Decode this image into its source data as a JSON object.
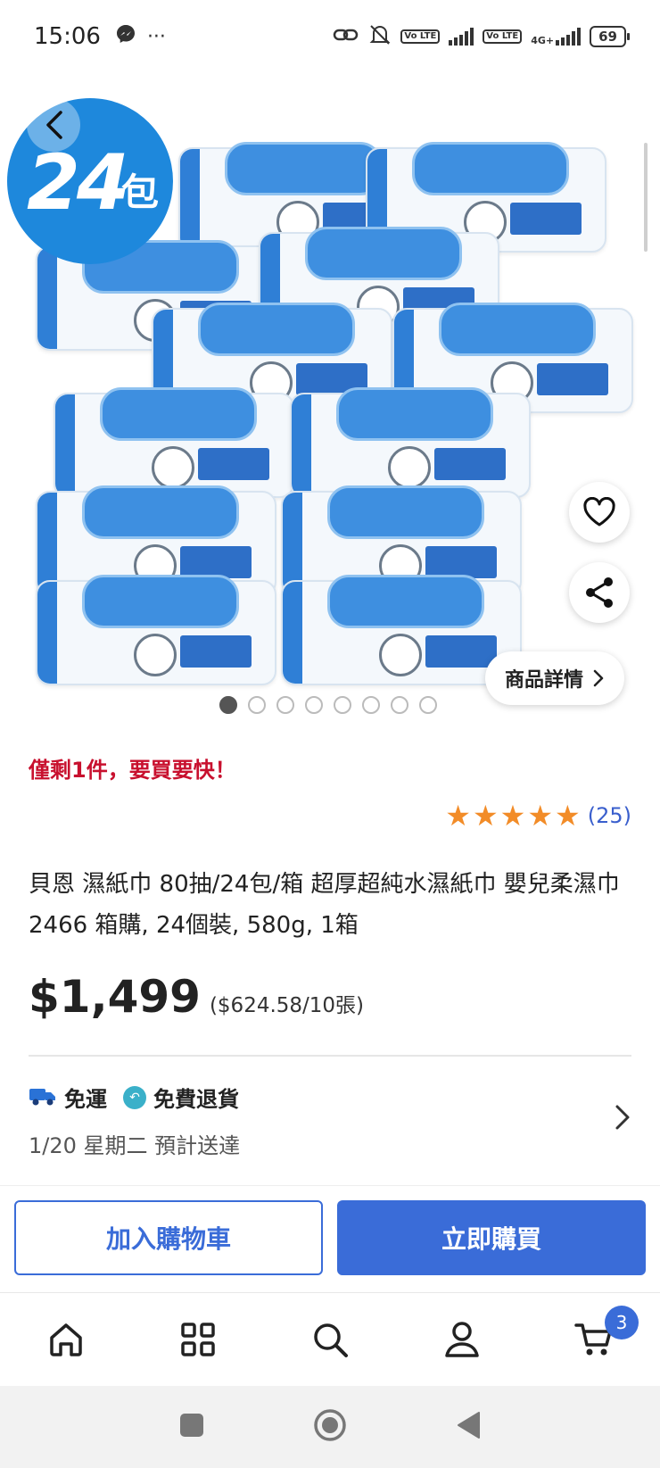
{
  "status_bar": {
    "time": "15:06",
    "battery": "69",
    "network": "4G+",
    "volte_label": "Vo LTE"
  },
  "gallery": {
    "badge_number": "24",
    "badge_unit": "包",
    "details_button": "商品詳情",
    "dot_count": 8,
    "active_dot": 0
  },
  "product": {
    "urgency": "僅剩1件，要買要快！",
    "rating_stars": 5,
    "rating_count": "(25)",
    "title": "貝恩 濕紙巾 80抽/24包/箱 超厚超純水濕紙巾 嬰兒柔濕巾 2466 箱購, 24個裝, 580g, 1箱",
    "price": "$1,499",
    "unit_price": "($624.58/10張)"
  },
  "shipping": {
    "free_shipping": "免運",
    "free_return": "免費退貨",
    "delivery": "1/20 星期二  預計送達"
  },
  "actions": {
    "add_to_cart": "加入購物車",
    "buy_now": "立即購買"
  },
  "tabbar": {
    "cart_count": "3"
  },
  "colors": {
    "accent": "#3a6cd8",
    "urgent": "#c8102e",
    "star": "#f28c28",
    "badge_blue": "#1e88dc"
  }
}
